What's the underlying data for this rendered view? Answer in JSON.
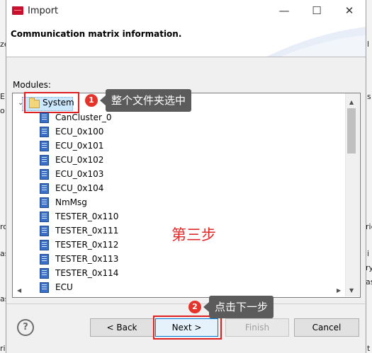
{
  "window": {
    "title": "Import",
    "minimize": "—",
    "maximize": "☐",
    "close": "✕"
  },
  "header": {
    "title": "Communication matrix information."
  },
  "modules": {
    "label": "Modules:",
    "root": "System",
    "items": [
      "CanCluster_0",
      "ECU_0x100",
      "ECU_0x101",
      "ECU_0x102",
      "ECU_0x103",
      "ECU_0x104",
      "NmMsg",
      "TESTER_0x110",
      "TESTER_0x111",
      "TESTER_0x112",
      "TESTER_0x113",
      "TESTER_0x114",
      "ECU"
    ]
  },
  "buttons": {
    "help": "?",
    "back": "< Back",
    "next": "Next >",
    "finish": "Finish",
    "cancel": "Cancel"
  },
  "annotations": {
    "step1_num": "1",
    "step1_text": "整个文件夹选中",
    "step2_num": "2",
    "step2_text": "点击下一步",
    "step3_text": "第三步"
  },
  "background": {
    "left_texts": [
      "ze",
      "E",
      "o",
      "ro",
      "as",
      "as",
      "ric)"
    ],
    "right_texts": [
      "l",
      "s",
      "ries",
      "i",
      "ry",
      "as",
      "t"
    ]
  },
  "colors": {
    "accent_red": "#e02020",
    "selection": "#cce8ff",
    "primary_border": "#0078d7"
  }
}
